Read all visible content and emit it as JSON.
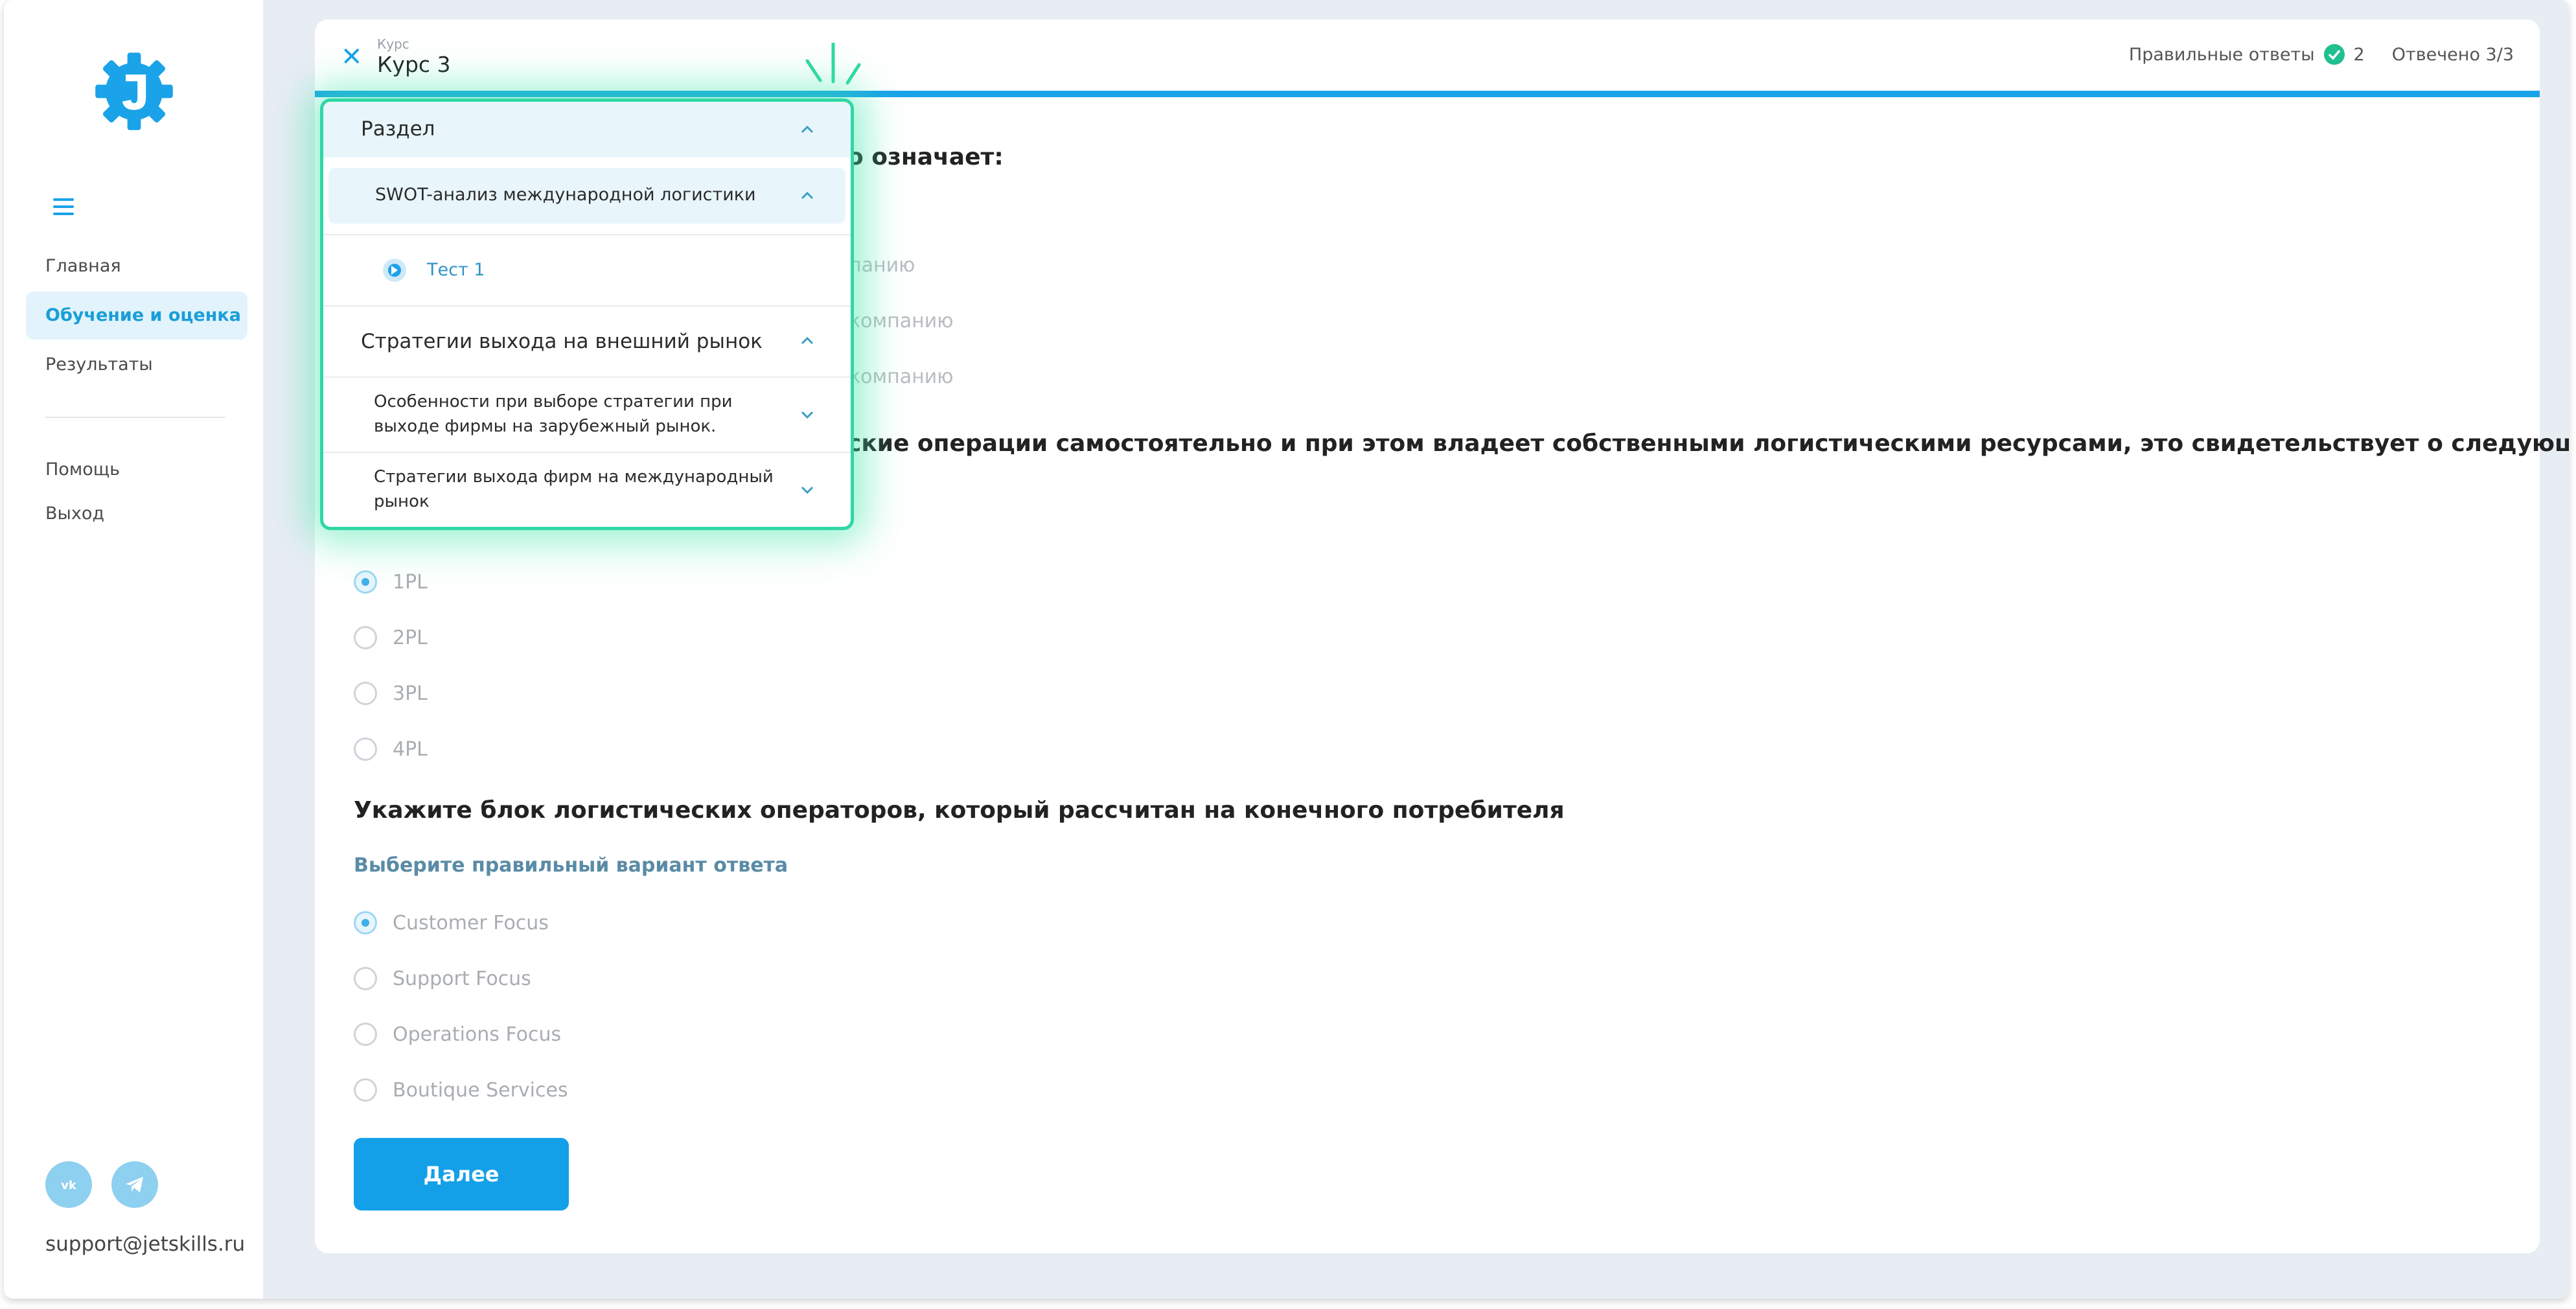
{
  "sidebar": {
    "nav": [
      "Главная",
      "Обучение и оценка",
      "Результаты"
    ],
    "nav2": [
      "Помощь",
      "Выход"
    ],
    "support_email": "support@jetskills.ru",
    "social": [
      "vk-icon",
      "telegram-icon"
    ]
  },
  "header": {
    "course_label": "Курс",
    "course_title": "Курс 3",
    "correct_label": "Правильные ответы",
    "correct_count": "2",
    "answered": "Отвечено 3/3"
  },
  "dropdown": {
    "section_label": "Раздел",
    "sub_label": "SWOT-анализ международной логистики",
    "test_label": "Тест 1",
    "section2_label": "Стратегии выхода на внешний рынок",
    "item1_line1": "Особенности при выборе стратегии при",
    "item1_line2": "выходе фирмы на зарубежный рынок.",
    "item2_line1": "Стратегии выхода фирм на международный",
    "item2_line2": "рынок"
  },
  "q1": {
    "text_visible": "о означает:",
    "options_visible": [
      "панию",
      "компанию",
      "компанию"
    ]
  },
  "q2": {
    "text_visible": "ские операции самостоятельно и при этом владеет собственными логистическими ресурсами, это свидетельствует о следующем",
    "options": [
      "1PL",
      "2PL",
      "3PL",
      "4PL"
    ],
    "selected": "1PL"
  },
  "q3": {
    "text": "Укажите блок логистических операторов, который рассчитан на конечного потребителя",
    "hint": "Выберите правильный вариант ответа",
    "options": [
      "Customer Focus",
      "Support Focus",
      "Operations Focus",
      "Boutique Services"
    ],
    "selected": "Customer Focus"
  },
  "next_button": "Далее",
  "colors": {
    "accent": "#1aa3e8",
    "highlight_border": "#2fd7a5",
    "correct": "#1fbf8f"
  }
}
